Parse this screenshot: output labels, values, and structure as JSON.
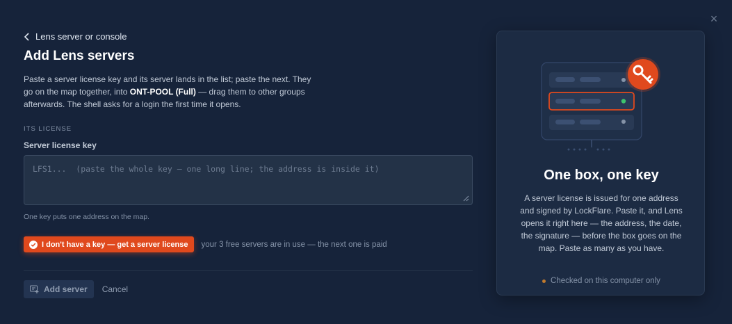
{
  "dialog": {
    "close_symbol": "×"
  },
  "header": {
    "back_label": "Lens server or console",
    "title": "Add Lens servers",
    "description_pre": "Paste a server license key and its server lands in the list; paste the next. They go on the map together, into ",
    "description_pool": "ONT-POOL (Full)",
    "description_post": " — drag them to other groups afterwards. The shell asks for a login the first time it opens."
  },
  "form": {
    "section_label": "ITS LICENSE",
    "field_label": "Server license key",
    "key_value": "",
    "key_placeholder": "LFS1...  (paste the whole key — one long line; the address is inside it)",
    "hint": "One key puts one address on the map."
  },
  "cta": {
    "label": "I don't have a key — get a server license",
    "note": "your 3 free servers are in use — the next one is paid"
  },
  "actions": {
    "add_label": "Add server",
    "cancel_label": "Cancel"
  },
  "info_card": {
    "title": "One box, one key",
    "body": "A server license is issued for one address and signed by LockFlare. Paste it, and Lens opens it right here — the address, the date, the signature — before the box goes on the map. Paste as many as you have.",
    "footer": "Checked on this computer only"
  },
  "colors": {
    "accent": "#e0491d",
    "background": "#16233a",
    "card": "#1c2b43",
    "status_ok": "#3ec46d"
  },
  "icons": {
    "back": "chevron-left-icon",
    "close": "close-icon",
    "cta": "check-circle-icon",
    "add": "add-server-icon",
    "illustration": "server-rack-icon",
    "key": "key-icon"
  }
}
